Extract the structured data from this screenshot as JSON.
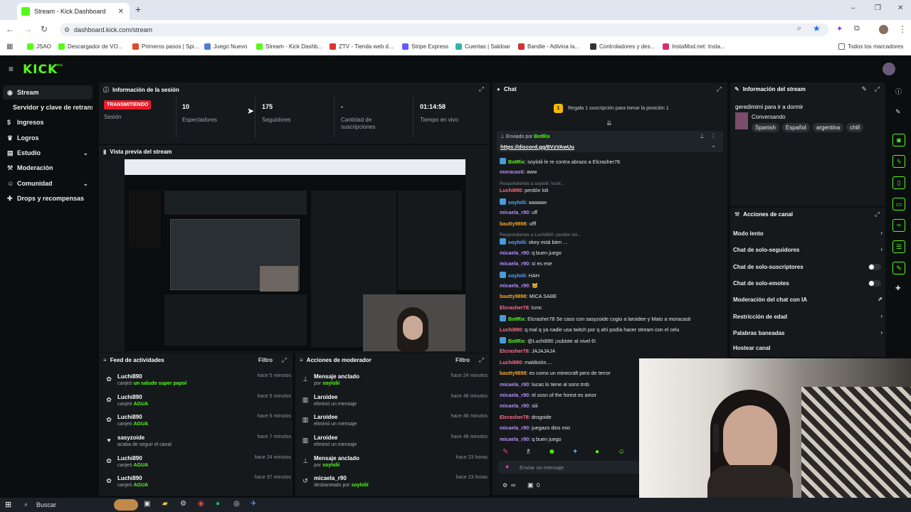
{
  "browser": {
    "tab_title": "Stream - Kick Dashboard",
    "new_tab": "+",
    "url": "dashboard.kick.com/stream",
    "window_controls": [
      "–",
      "❐",
      "✕"
    ],
    "bookmarks": [
      {
        "label": "JSAO",
        "color": "#53fc18"
      },
      {
        "label": "Descargador de VO...",
        "color": "#53fc18"
      },
      {
        "label": "Primeros pasos | Spi...",
        "color": "#e0492b"
      },
      {
        "label": "Juego Nuevo",
        "color": "#4a7fd6"
      },
      {
        "label": "Stream - Kick Dashb...",
        "color": "#53fc18"
      },
      {
        "label": "ZTV - Tienda web d...",
        "color": "#d33"
      },
      {
        "label": "Stripe Express",
        "color": "#635bff"
      },
      {
        "label": "Cuentas | Saldoar",
        "color": "#2fb5a8"
      },
      {
        "label": "Bandie - Adivina la...",
        "color": "#c33"
      },
      {
        "label": "Controladores y des...",
        "color": "#333"
      },
      {
        "label": "InstaMod.net: Insta...",
        "color": "#d6306b"
      }
    ],
    "all_bookmarks": "Todos los marcadores"
  },
  "header": {
    "logo": "KICK",
    "logo_suffix": "beta"
  },
  "sidebar": {
    "items": [
      {
        "label": "Stream",
        "icon": "broadcast-icon"
      },
      {
        "label": "Servidor y clave de retransmisión",
        "icon": ""
      },
      {
        "label": "Ingresos",
        "icon": "dollar-icon"
      },
      {
        "label": "Logros",
        "icon": "trophy-icon"
      },
      {
        "label": "Estudio",
        "icon": "layers-icon"
      },
      {
        "label": "Moderación",
        "icon": "hammer-icon"
      },
      {
        "label": "Comunidad",
        "icon": "users-icon"
      },
      {
        "label": "Drops y recompensas",
        "icon": "gift-icon"
      }
    ]
  },
  "session": {
    "title": "Información de la sesión",
    "status_badge": "TRANSMITIENDO",
    "status_label": "Sesión",
    "viewers": "10",
    "viewers_label": "Espectadores",
    "followers": "175",
    "followers_label": "Seguidores",
    "subs": "-",
    "subs_label": "Cantidad de suscripciones",
    "uptime": "01:14:58",
    "uptime_label": "Tiempo en vivo"
  },
  "preview": {
    "title": "Vista previa del stream"
  },
  "feed": {
    "title": "Feed de actividades",
    "filter": "Filtro",
    "items": [
      {
        "name": "Luchi890",
        "desc": "canjeó",
        "reward": "un saludo super papol",
        "time": "hace 5 minutos",
        "icon": "redeem-icon"
      },
      {
        "name": "Luchi890",
        "desc": "canjeó",
        "reward": "AGUA",
        "time": "hace 5 minutos",
        "icon": "redeem-icon"
      },
      {
        "name": "Luchi890",
        "desc": "canjeó",
        "reward": "AGUA",
        "time": "hace 6 minutos",
        "icon": "redeem-icon"
      },
      {
        "name": "sasyzoide",
        "desc": "acaba de seguir el canal",
        "reward": "",
        "time": "hace 7 minutos",
        "icon": "heart-icon"
      },
      {
        "name": "Luchi890",
        "desc": "canjeó",
        "reward": "AGUA",
        "time": "hace 24 minutos",
        "icon": "redeem-icon"
      },
      {
        "name": "Luchi890",
        "desc": "canjeó",
        "reward": "AGUA",
        "time": "hace 37 minutos",
        "icon": "redeem-icon"
      }
    ]
  },
  "modactions": {
    "title": "Acciones de moderador",
    "filter": "Filtro",
    "items": [
      {
        "name": "Mensaje anclado",
        "desc": "por",
        "who": "soylolii",
        "time": "hace 24 minutos",
        "icon": "pin-icon"
      },
      {
        "name": "Laroidee",
        "desc": "eliminó un mensaje",
        "who": "",
        "time": "hace 48 minutos",
        "icon": "trash-icon"
      },
      {
        "name": "Laroidee",
        "desc": "eliminó un mensaje",
        "who": "",
        "time": "hace 48 minutos",
        "icon": "trash-icon"
      },
      {
        "name": "Laroidee",
        "desc": "eliminó un mensaje",
        "who": "",
        "time": "hace 48 minutos",
        "icon": "trash-icon"
      },
      {
        "name": "Mensaje anclado",
        "desc": "por",
        "who": "soylolii",
        "time": "hace 23 horas",
        "icon": "pin-icon"
      },
      {
        "name": "micaela_r90",
        "desc": "desbaneado por",
        "who": "soylolii",
        "time": "hace 23 horas",
        "icon": "undo-icon"
      }
    ]
  },
  "chat": {
    "title": "Chat",
    "gift_banner": "Regala 1 suscripción para tomar la posición 1",
    "pinned_by": "Enviado por",
    "pinned_user": "BotRix",
    "pinned_link": "https://discord.gg/8VzVAwUu",
    "input_placeholder": "Enviar un mensaje",
    "bottom_left": "∞",
    "bottom_count": "0",
    "messages": [
      {
        "user": "BotRix",
        "color": "#53fc18",
        "text": ": soylolii le re contra abrazo a Elcrasher78",
        "bot": true
      },
      {
        "user": "moracasti",
        "color": "#b78cf5",
        "text": ": aww"
      },
      {
        "reply": "Respondiendo a soylolii: luchi..."
      },
      {
        "user": "Luchi890",
        "color": "#ff6b8a",
        "text": ": perdón loli"
      },
      {
        "user": "soylolii",
        "color": "#53a4ff",
        "text": ": aaaaaw",
        "bot": true
      },
      {
        "user": "micaela_r90",
        "color": "#b78cf5",
        "text": ": uff"
      },
      {
        "user": "bautty9898",
        "color": "#f5a623",
        "text": ": ufff"
      },
      {
        "reply": "Respondiendo a Luchi890: perdón loli..."
      },
      {
        "user": "soylolii",
        "color": "#53a4ff",
        "text": ": okey está bien ...",
        "bot": true
      },
      {
        "user": "micaela_r90",
        "color": "#b78cf5",
        "text": ": q buen juego"
      },
      {
        "user": "micaela_r90",
        "color": "#b78cf5",
        "text": ": si es ese"
      },
      {
        "user": "soylolii",
        "color": "#53a4ff",
        "text": ": HAH",
        "bot": true
      },
      {
        "user": "micaela_r90",
        "color": "#b78cf5",
        "text": ": 🐱"
      },
      {
        "user": "bautty9898",
        "color": "#f5a623",
        "text": ": MICA SABE"
      },
      {
        "user": "Elcrasher78",
        "color": "#ff6b8a",
        "text": ": lcmc"
      },
      {
        "user": "BotRix",
        "color": "#53fc18",
        "text": ": Elcrasher78 Se caso con sasyzoide cogio a laroidee y Mato a moracasti",
        "bot": true
      },
      {
        "user": "Luchi890",
        "color": "#ff6b8a",
        "text": ": q mal q ya nadie usa twitch por q ahí podía hacer stream con el celu"
      },
      {
        "user": "BotRix",
        "color": "#53fc18",
        "text": ": @Luchi890 ¡subiste al nivel 6!",
        "bot": true
      },
      {
        "user": "Elcrasher78",
        "color": "#ff6b8a",
        "text": ": JAJAJAJA"
      },
      {
        "user": "Luchi890",
        "color": "#ff6b8a",
        "text": ": maldición...."
      },
      {
        "user": "bautty9898",
        "color": "#f5a623",
        "text": ": es como un minecraft pero de terror"
      },
      {
        "user": "micaela_r90",
        "color": "#b78cf5",
        "text": ": lucas lo tiene al sons tmb"
      },
      {
        "user": "micaela_r90",
        "color": "#b78cf5",
        "text": ": el sosn of the forest es amor"
      },
      {
        "user": "micaela_r90",
        "color": "#b78cf5",
        "text": ": siii"
      },
      {
        "user": "Elcrasher78",
        "color": "#ff6b8a",
        "text": ": drogoide"
      },
      {
        "user": "micaela_r90",
        "color": "#b78cf5",
        "text": ": juegazo dios mio"
      },
      {
        "user": "micaela_r90",
        "color": "#b78cf5",
        "text": ": q buen juego"
      }
    ]
  },
  "stream_info": {
    "title": "Información del stream",
    "stream_title": "geredimimi para ir a dormir",
    "category": "Conversando",
    "tags": [
      "Spanish",
      "Español",
      "argentina",
      "chill"
    ]
  },
  "channel_actions": {
    "title": "Acciones de canal",
    "items": [
      {
        "label": "Modo lento",
        "control": "arrow"
      },
      {
        "label": "Chat de solo-seguidores",
        "control": "arrow"
      },
      {
        "label": "Chat de solo-suscriptores",
        "control": "toggle"
      },
      {
        "label": "Chat de solo-emotes",
        "control": "toggle"
      },
      {
        "label": "Moderación del chat con IA",
        "control": "link"
      },
      {
        "label": "Restricción de edad",
        "control": "arrow"
      },
      {
        "label": "Palabras baneadas",
        "control": "arrow"
      },
      {
        "label": "Hostear canal",
        "control": "none"
      }
    ]
  },
  "taskbar": {
    "search": "Buscar"
  }
}
